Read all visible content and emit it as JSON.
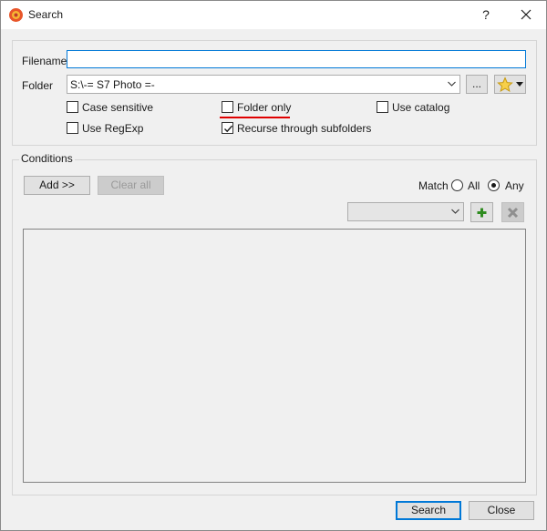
{
  "window": {
    "title": "Search",
    "help_label": "?",
    "icon": "app-flower-icon"
  },
  "form": {
    "filename_label": "Filename",
    "filename_value": "",
    "folder_label": "Folder",
    "folder_value": "S:\\-= S7 Photo =-",
    "browse_label": "...",
    "favorites_icon": "star-icon"
  },
  "options": {
    "case_sensitive": {
      "label": "Case sensitive",
      "checked": false
    },
    "folder_only": {
      "label": "Folder only",
      "checked": false
    },
    "use_catalog": {
      "label": "Use catalog",
      "checked": false
    },
    "use_regexp": {
      "label": "Use RegExp",
      "checked": false
    },
    "recurse": {
      "label": "Recurse through subfolders",
      "checked": true
    }
  },
  "conditions": {
    "group_label": "Conditions",
    "add_label": "Add >>",
    "clear_all_label": "Clear all",
    "match_label": "Match",
    "match_all_label": "All",
    "match_any_label": "Any",
    "match_selected": "Any",
    "condition_select_value": ""
  },
  "footer": {
    "search_label": "Search",
    "close_label": "Close"
  },
  "colors": {
    "accent": "#0078d7",
    "annotation": "#e00000"
  }
}
